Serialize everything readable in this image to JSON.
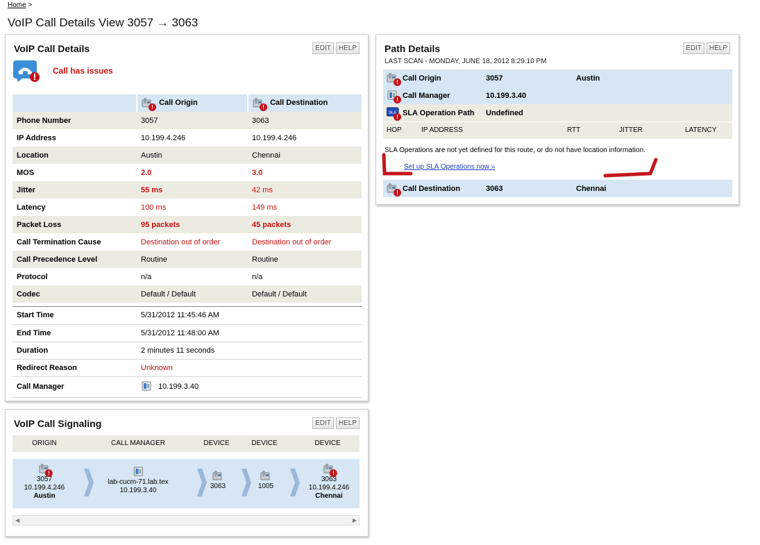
{
  "breadcrumb": {
    "home": "Home",
    "sep": ">"
  },
  "page_title": "VoIP Call Details View 3057 → 3063",
  "details": {
    "title": "VoIP Call Details",
    "edit": "EDIT",
    "help": "HELP",
    "issue": "Call has issues",
    "col_origin": "Call Origin",
    "col_dest": "Call Destination",
    "rows": [
      {
        "label": "Phone Number",
        "origin": "3057",
        "dest": "3063"
      },
      {
        "label": "IP Address",
        "origin": "10.199.4.246",
        "dest": "10.199.4.246"
      },
      {
        "label": "Location",
        "origin": "Austin",
        "dest": "Chennai"
      },
      {
        "label": "MOS",
        "origin": "2.0",
        "dest": "3.0"
      },
      {
        "label": "Jitter",
        "origin": "55 ms",
        "dest": "42 ms"
      },
      {
        "label": "Latency",
        "origin": "100 ms",
        "dest": "149 ms"
      },
      {
        "label": "Packet Loss",
        "origin": "95 packets",
        "dest": "45 packets"
      },
      {
        "label": "Call Termination Cause",
        "origin": "Destination out of order",
        "dest": "Destination out of order"
      },
      {
        "label": "Call Precedence Level",
        "origin": "Routine",
        "dest": "Routine"
      },
      {
        "label": "Protocol",
        "origin": "n/a",
        "dest": "n/a"
      },
      {
        "label": "Codec",
        "origin": "Default / Default",
        "dest": "Default / Default"
      }
    ],
    "rows2": [
      {
        "label": "Start Time",
        "value": "5/31/2012 11:45:46 AM"
      },
      {
        "label": "End Time",
        "value": "5/31/2012 11:48:00 AM"
      },
      {
        "label": "Duration",
        "value": "2 minutes 11 seconds"
      },
      {
        "label": "Redirect Reason",
        "value": "Unknown"
      },
      {
        "label": "Call Manager",
        "value": "10.199.3.40"
      }
    ]
  },
  "path": {
    "title": "Path Details",
    "edit": "EDIT",
    "help": "HELP",
    "last_scan": "LAST SCAN - MONDAY, JUNE 18, 2012 8:29:10 PM",
    "origin": {
      "label": "Call Origin",
      "value": "3057",
      "city": "Austin"
    },
    "manager": {
      "label": "Call Manager",
      "value": "10.199.3.40"
    },
    "sla_path": {
      "label": "SLA Operation Path",
      "value": "Undefined",
      "icon_text": "SLA"
    },
    "hop_headers": {
      "hop": "HOP",
      "ip": "IP ADDRESS",
      "rtt": "RTT",
      "jitter": "JITTER",
      "latency": "LATENCY"
    },
    "sla_message": "SLA Operations are not yet defined for this route, or do not have location information.",
    "sla_link": "Set up SLA Operations now »",
    "destination": {
      "label": "Call Destination",
      "value": "3063",
      "city": "Chennai"
    }
  },
  "signal": {
    "title": "VoIP Call Signaling",
    "edit": "EDIT",
    "help": "HELP",
    "headers": [
      "ORIGIN",
      "CALL MANAGER",
      "DEVICE",
      "DEVICE",
      "DEVICE"
    ],
    "nodes": [
      {
        "line1": "3057",
        "line2": "10.199.4.246",
        "line3": "Austin"
      },
      {
        "line1": "lab-cucm-71.lab.tex",
        "line2": "10.199.3.40",
        "line3": ""
      },
      {
        "line1": "3063",
        "line2": "",
        "line3": ""
      },
      {
        "line1": "1005",
        "line2": "",
        "line3": ""
      },
      {
        "line1": "3063",
        "line2": "10.199.4.246",
        "line3": "Chennai"
      }
    ]
  },
  "colors": {
    "accent_red": "#cc1111",
    "header_blue": "#d6e6f4",
    "row_beige": "#ecebe2"
  }
}
